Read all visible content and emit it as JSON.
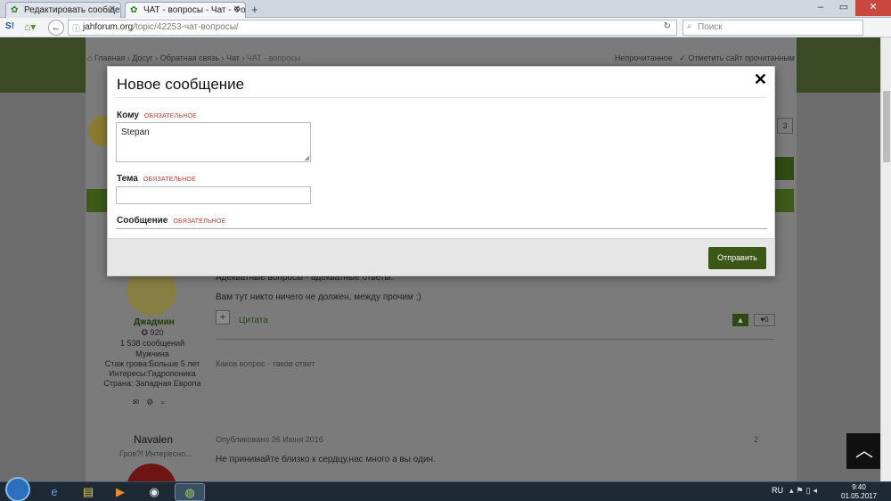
{
  "browser": {
    "tabs": [
      {
        "label": "Редактировать сообщени..."
      },
      {
        "label": "ЧАТ - вопросы - Чат - Фо..."
      }
    ],
    "new_tab": "+",
    "url_domain": "jahforum.org",
    "url_path": "/topic/42253-чат-вопросы/",
    "search_placeholder": "Поиск",
    "window_buttons": {
      "minimize": "–",
      "maximize": "▭",
      "close": "✕"
    }
  },
  "page": {
    "breadcrumbs": [
      "Главная",
      "Досуг",
      "Обратная связь",
      "Чат",
      "ЧАТ - вопросы"
    ],
    "unread_label": "Непрочитанное",
    "mark_read_label": "Отметить сайт прочитанным",
    "pager_value": "3",
    "post1": {
      "text1": "Адекватные вопросы - адекватные ответы.",
      "text2": "Вам тут никто ничего не должен, между прочим ;)",
      "author": "Джадмин",
      "reputation": "920",
      "messages": "1 538 сообщений",
      "gender": "Мужчина",
      "experience": "Стаж гровa:Больше 5 лет",
      "interests": "Интересы:Гидропоника",
      "country": "Страна: Западная Европа",
      "quote_label": "Цитата",
      "likes": "0",
      "signature": "Каков вопрос - таков ответ"
    },
    "post2": {
      "author": "Navalen",
      "subtitle": "Гров?! Интересно...",
      "published": "Опубликовано 26 Июня 2016",
      "text": "Не принимайте близко к сердцу,нас много а вы один.",
      "count": "2"
    }
  },
  "modal": {
    "title": "Новое сообщение",
    "close_icon": "✕",
    "to_label": "Кому",
    "to_required": "ОБЯЗАТЕЛЬНОЕ",
    "to_value": "Stepan",
    "subject_label": "Тема",
    "subject_required": "ОБЯЗАТЕЛЬНОЕ",
    "subject_value": "",
    "message_label": "Сообщение",
    "message_required": "ОБЯЗАТЕЛЬНОЕ",
    "send_label": "Отправить"
  },
  "taskbar": {
    "lang": "RU",
    "time": "9:40",
    "date": "01.05.2017"
  },
  "colors": {
    "accent_green": "#3b5716",
    "required_red": "#c0392b"
  }
}
